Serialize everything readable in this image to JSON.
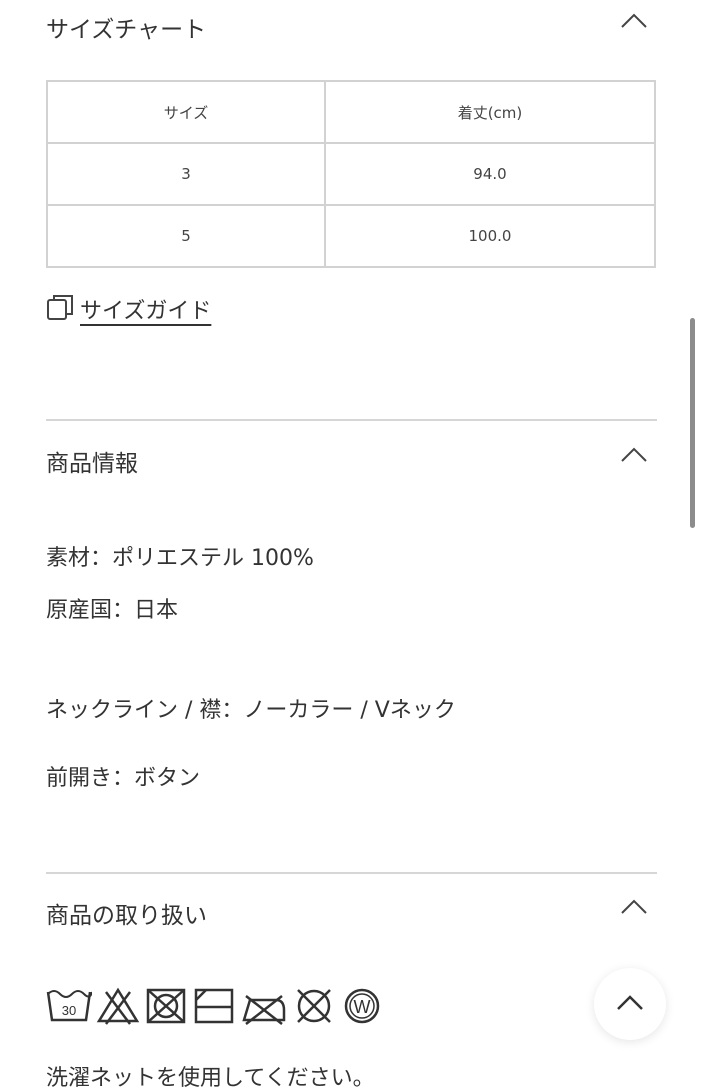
{
  "size_chart": {
    "title": "サイズチャート",
    "columns": [
      "サイズ",
      "着丈(cm)"
    ],
    "rows": [
      [
        "3",
        "94.0"
      ],
      [
        "5",
        "100.0"
      ]
    ],
    "size_guide_label": "サイズガイド"
  },
  "product_info": {
    "title": "商品情報",
    "material": "素材：ポリエステル 100%",
    "origin": "原産国：日本",
    "neckline": "ネックライン / 襟：ノーカラー / Vネック",
    "front_opening": "前開き：ボタン"
  },
  "care": {
    "title": "商品の取り扱い",
    "wash_temp": "30",
    "wet_clean_mark": "W",
    "icons": [
      "wash-30-icon",
      "no-bleach-icon",
      "no-tumble-dry-icon",
      "line-dry-shade-icon",
      "no-iron-icon",
      "no-dry-clean-icon",
      "wet-clean-icon"
    ],
    "note": "洗濯ネットを使用してください。"
  },
  "colors": {
    "text": "#333333",
    "border": "#d2d2d2",
    "divider": "#d6d6d6"
  }
}
